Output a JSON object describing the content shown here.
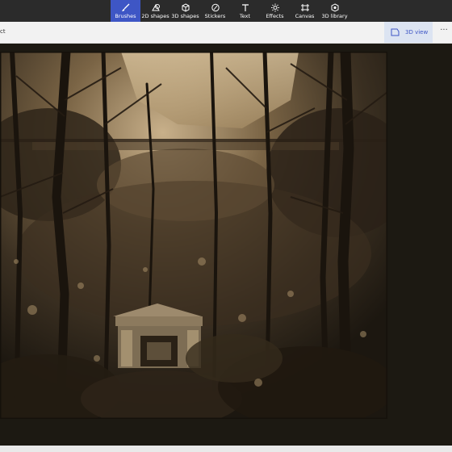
{
  "toolbar": {
    "items": [
      {
        "label": "Brushes",
        "icon": "brush-icon",
        "active": true
      },
      {
        "label": "2D shapes",
        "icon": "2d-shapes-icon"
      },
      {
        "label": "3D shapes",
        "icon": "3d-shapes-icon"
      },
      {
        "label": "Stickers",
        "icon": "stickers-icon"
      },
      {
        "label": "Text",
        "icon": "text-icon"
      },
      {
        "label": "Effects",
        "icon": "effects-icon"
      },
      {
        "label": "Canvas",
        "icon": "canvas-icon"
      },
      {
        "label": "3D library",
        "icon": "3d-library-icon"
      }
    ],
    "accent": "#3e56c5"
  },
  "subbar": {
    "left_text": "ct",
    "view3d_label": "3D view",
    "more_label": "···"
  },
  "canvas": {
    "description_colors": {
      "sepia_dark": "#1c1710",
      "sepia_light": "#c8b08a"
    }
  }
}
